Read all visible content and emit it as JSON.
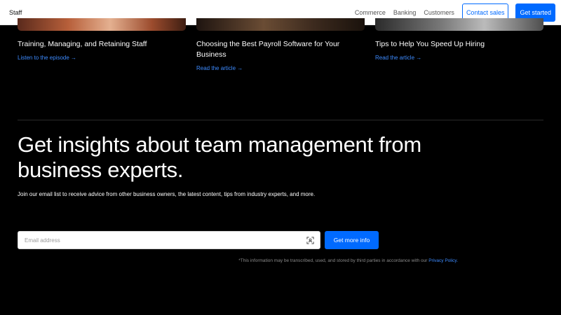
{
  "header": {
    "brand": "Staff",
    "nav": [
      "Commerce",
      "Banking",
      "Customers"
    ],
    "contact_label": "Contact sales",
    "cta_label": "Get started"
  },
  "articles": [
    {
      "title": "Training, Managing, and Retaining Staff",
      "link": "Listen to the episode →"
    },
    {
      "title": "Choosing the Best Payroll Software for Your Business",
      "link": "Read the article →"
    },
    {
      "title": "Tips to Help You Speed Up Hiring",
      "link": "Read the article →"
    }
  ],
  "signup": {
    "headline": "Get insights about team management from business experts.",
    "subtext": "Join our email list to receive advice from other business owners, the latest content, tips from industry experts, and more.",
    "email_placeholder": "Email address",
    "submit_label": "Get more info",
    "disclaimer": "*This information may be transcribed, used, and stored by third parties in accordance with our",
    "policy_link": "Privacy Policy.",
    "scan_icon": "scan-icon"
  },
  "colors": {
    "accent": "#006aff",
    "link": "#3d8bff",
    "background": "#000000"
  }
}
